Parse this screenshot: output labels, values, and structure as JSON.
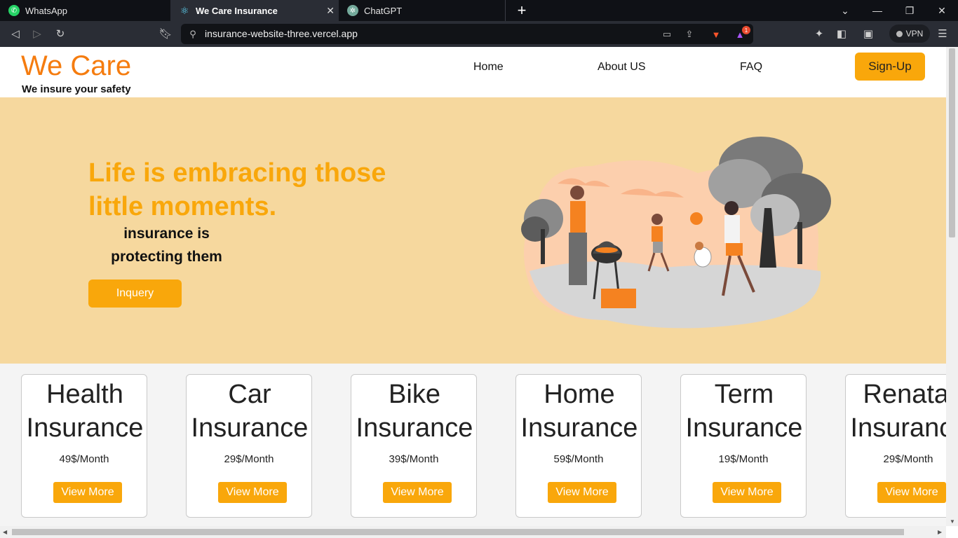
{
  "browser": {
    "tabs": [
      {
        "title": "WhatsApp",
        "icon": "whatsapp-icon"
      },
      {
        "title": "We Care Insurance",
        "icon": "react-icon"
      },
      {
        "title": "ChatGPT",
        "icon": "chatgpt-icon"
      }
    ],
    "url": "insurance-website-three.vercel.app",
    "vpn_label": "VPN",
    "notification_count": "1"
  },
  "site": {
    "logo": "We Care",
    "tagline": "We insure your safety",
    "nav": [
      "Home",
      "About US",
      "FAQ"
    ],
    "signup_label": "Sign-Up"
  },
  "hero": {
    "title": "Life is embracing those little moments.",
    "subtitle": "insurance is protecting them",
    "button_label": "Inquery"
  },
  "cards": [
    {
      "title_line1": "Health",
      "title_line2": "Insurance",
      "price": "49$/Month",
      "button": "View More"
    },
    {
      "title_line1": "Car",
      "title_line2": "Insurance",
      "price": "29$/Month",
      "button": "View More"
    },
    {
      "title_line1": "Bike",
      "title_line2": "Insurance",
      "price": "39$/Month",
      "button": "View More"
    },
    {
      "title_line1": "Home",
      "title_line2": "Insurance",
      "price": "59$/Month",
      "button": "View More"
    },
    {
      "title_line1": "Term",
      "title_line2": "Insurance",
      "price": "19$/Month",
      "button": "View More"
    },
    {
      "title_line1": "Renatal",
      "title_line2": "Insurance",
      "price": "29$/Month",
      "button": "View More"
    }
  ],
  "colors": {
    "brand_orange": "#f57c0f",
    "accent": "#f9a70b",
    "hero_bg": "#f6d89e"
  }
}
